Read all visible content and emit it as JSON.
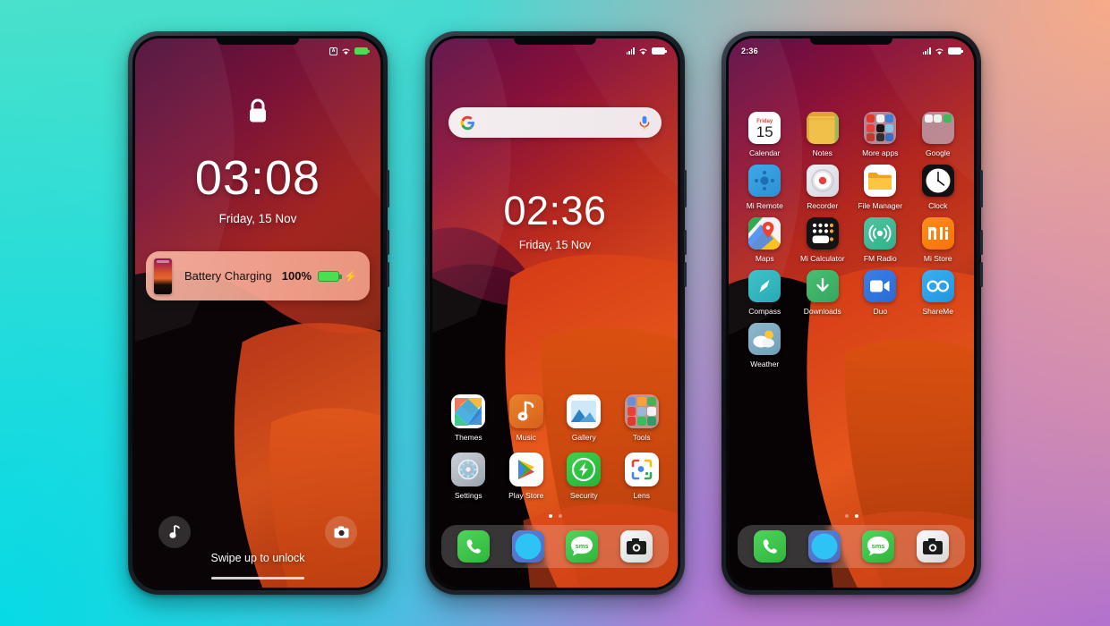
{
  "background": {
    "colors": {
      "top_left": "#4fe0c9",
      "bottom_left": "#07dae4",
      "top_right": "#f7ab88",
      "bottom_right": "#ad6ed2"
    }
  },
  "phones": [
    {
      "id": "lock-screen",
      "status_bar": {
        "time": "",
        "icons": [
          "screenshot-icon",
          "wifi-icon",
          "battery-charging-icon"
        ]
      },
      "lock_icon": "lock-icon",
      "clock": {
        "time": "03:08",
        "date": "Friday, 15 Nov"
      },
      "notification": {
        "title": "Battery Charging",
        "percent": "100%",
        "battery_icon": "battery-full-icon",
        "bolt_icon": "charging-bolt-icon"
      },
      "shortcuts": [
        {
          "name": "music-shortcut",
          "icon": "music-note-icon"
        },
        {
          "name": "camera-shortcut",
          "icon": "camera-icon"
        }
      ],
      "hint": "Swipe up to unlock"
    },
    {
      "id": "home-screen",
      "status_bar": {
        "time": "",
        "icons": [
          "signal-icon",
          "wifi-icon",
          "battery-icon"
        ]
      },
      "search": {
        "placeholder": "",
        "left_icon": "google-g-icon",
        "right_icon": "microphone-icon"
      },
      "clock": {
        "time": "02:36",
        "date": "Friday, 15 Nov"
      },
      "apps": [
        {
          "label": "Themes",
          "icon": "themes-icon"
        },
        {
          "label": "Music",
          "icon": "music-icon"
        },
        {
          "label": "Gallery",
          "icon": "gallery-icon"
        },
        {
          "label": "Tools",
          "icon": "tools-folder-icon"
        },
        {
          "label": "Settings",
          "icon": "settings-icon"
        },
        {
          "label": "Play Store",
          "icon": "play-store-icon"
        },
        {
          "label": "Security",
          "icon": "security-icon"
        },
        {
          "label": "Lens",
          "icon": "google-lens-icon"
        }
      ],
      "page_dots": {
        "count": 2,
        "active": 0
      },
      "dock": [
        {
          "label": "Phone",
          "icon": "phone-icon"
        },
        {
          "label": "Browser",
          "icon": "browser-icon"
        },
        {
          "label": "Messages",
          "icon": "sms-icon"
        },
        {
          "label": "Camera",
          "icon": "camera-icon"
        }
      ]
    },
    {
      "id": "app-drawer",
      "status_bar": {
        "time": "2:36",
        "icons": [
          "signal-icon",
          "wifi-icon",
          "battery-icon"
        ]
      },
      "apps": [
        {
          "label": "Calendar",
          "icon": "calendar-icon",
          "day": "15",
          "weekday": "Friday"
        },
        {
          "label": "Notes",
          "icon": "notes-icon"
        },
        {
          "label": "More apps",
          "icon": "more-apps-folder-icon"
        },
        {
          "label": "Google",
          "icon": "google-folder-icon"
        },
        {
          "label": "Mi Remote",
          "icon": "mi-remote-icon"
        },
        {
          "label": "Recorder",
          "icon": "recorder-icon"
        },
        {
          "label": "File Manager",
          "icon": "file-manager-icon"
        },
        {
          "label": "Clock",
          "icon": "clock-icon"
        },
        {
          "label": "Maps",
          "icon": "maps-icon"
        },
        {
          "label": "Mi Calculator",
          "icon": "calculator-icon"
        },
        {
          "label": "FM Radio",
          "icon": "fm-radio-icon"
        },
        {
          "label": "Mi Store",
          "icon": "mi-store-icon"
        },
        {
          "label": "Compass",
          "icon": "compass-icon"
        },
        {
          "label": "Downloads",
          "icon": "downloads-icon"
        },
        {
          "label": "Duo",
          "icon": "duo-icon"
        },
        {
          "label": "ShareMe",
          "icon": "shareme-icon"
        },
        {
          "label": "Weather",
          "icon": "weather-icon"
        }
      ],
      "page_dots": {
        "count": 2,
        "active": 1
      },
      "dock": [
        {
          "label": "Phone",
          "icon": "phone-icon"
        },
        {
          "label": "Browser",
          "icon": "browser-icon"
        },
        {
          "label": "Messages",
          "icon": "sms-icon"
        },
        {
          "label": "Camera",
          "icon": "camera-icon"
        }
      ]
    }
  ]
}
